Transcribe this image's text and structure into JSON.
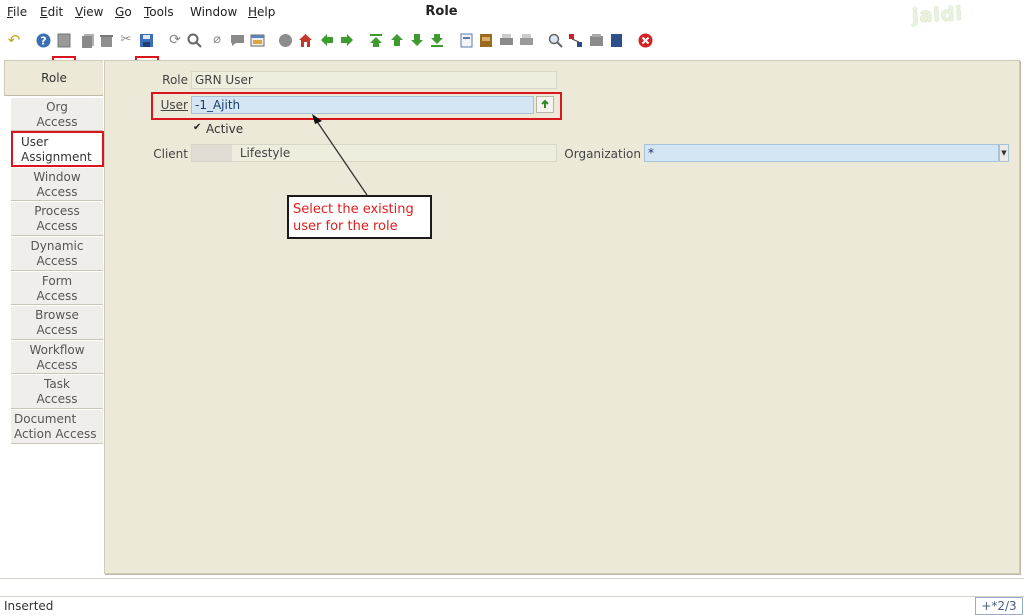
{
  "menubar": {
    "items": [
      {
        "underline": "F",
        "rest": "ile"
      },
      {
        "underline": "E",
        "rest": "dit"
      },
      {
        "underline": "V",
        "rest": "iew"
      },
      {
        "underline": "G",
        "rest": "o"
      },
      {
        "underline": "T",
        "rest": "ools"
      },
      {
        "underline": "",
        "rest": "Window"
      },
      {
        "underline": "H",
        "rest": "elp"
      }
    ],
    "title": "Role",
    "logo": "jaldi"
  },
  "toolbar": {
    "icons": [
      "undo-icon",
      "help-icon",
      "new-record-icon",
      "copy-record-icon",
      "delete-record-icon",
      "delete-selection-icon",
      "save-icon",
      "refresh-icon",
      "find-icon",
      "attachment-icon",
      "chat-icon",
      "grid-toggle-icon",
      "history-icon",
      "home-icon",
      "back-icon",
      "forward-icon",
      "first-record-icon",
      "previous-record-icon",
      "next-record-icon",
      "last-record-icon",
      "report-icon",
      "archive-icon",
      "print-icon",
      "print-preview-icon",
      "zoom-across-icon",
      "workflow-icon",
      "product-info-icon",
      "request-icon",
      "exit-icon"
    ]
  },
  "tabs": {
    "top": "Role",
    "items": [
      {
        "line1": "Org",
        "line2": "Access"
      },
      {
        "line1": "User",
        "line2": "Assignment"
      },
      {
        "line1": "Window",
        "line2": "Access"
      },
      {
        "line1": "Process",
        "line2": "Access"
      },
      {
        "line1": "Dynamic",
        "line2": "Access"
      },
      {
        "line1": "Form",
        "line2": "Access"
      },
      {
        "line1": "Browse",
        "line2": "Access"
      },
      {
        "line1": "Workflow",
        "line2": "Access"
      },
      {
        "line1": "Task",
        "line2": "Access"
      },
      {
        "line1": "Document",
        "line2": "Action Access"
      }
    ]
  },
  "form": {
    "role_label": "Role",
    "role_value": "GRN User",
    "user_label": "User",
    "user_value": "-1_Ajith",
    "active_label": "Active",
    "active_checked": true,
    "client_label": "Client",
    "client_value": "Lifestyle",
    "org_label": "Organization",
    "org_value": "*"
  },
  "annotation": {
    "text_line1": "Select the existing",
    "text_line2": "user for the role"
  },
  "status": {
    "text": "Inserted",
    "count": "+*2/3"
  },
  "colors": {
    "highlight": "#d9151d",
    "field_blue": "#d4e6f4",
    "panel_bg": "#ece9d8"
  }
}
